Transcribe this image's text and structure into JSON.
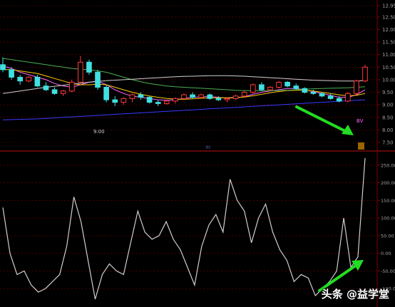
{
  "chart_data": [
    {
      "type": "candlestick",
      "y_axis_ticks": [
        "12.95",
        "12.50",
        "12.00",
        "11.50",
        "11.00",
        "10.50",
        "10.00",
        "9.50",
        "9.00",
        "8.50",
        "8.00",
        "7.50"
      ],
      "ylim": [
        7.5,
        12.95
      ],
      "low_marker_label": "9.00",
      "event_markers": [
        "!!!"
      ],
      "indicator_label": "BV",
      "series": [
        {
          "kind": "candles",
          "ohlc": [
            [
              10.6,
              10.9,
              10.3,
              10.4
            ],
            [
              10.4,
              10.5,
              10.0,
              10.1
            ],
            [
              10.1,
              10.2,
              9.8,
              9.95
            ],
            [
              9.95,
              10.15,
              9.9,
              10.1
            ],
            [
              10.1,
              10.2,
              9.7,
              9.75
            ],
            [
              9.75,
              9.9,
              9.55,
              9.6
            ],
            [
              9.6,
              9.7,
              9.4,
              9.45
            ],
            [
              9.45,
              9.6,
              9.35,
              9.55
            ],
            [
              9.55,
              10.0,
              9.5,
              9.9
            ],
            [
              9.9,
              10.95,
              9.85,
              10.7
            ],
            [
              10.7,
              10.8,
              10.2,
              10.3
            ],
            [
              10.3,
              10.4,
              9.6,
              9.7
            ],
            [
              9.7,
              9.8,
              9.1,
              9.2
            ],
            [
              9.2,
              9.35,
              8.95,
              9.1
            ],
            [
              9.1,
              9.3,
              9.0,
              9.25
            ],
            [
              9.25,
              9.45,
              9.1,
              9.4
            ],
            [
              9.4,
              9.5,
              9.2,
              9.3
            ],
            [
              9.3,
              9.35,
              9.05,
              9.1
            ],
            [
              9.1,
              9.2,
              8.95,
              9.05
            ],
            [
              9.05,
              9.2,
              9.0,
              9.15
            ],
            [
              9.15,
              9.3,
              9.05,
              9.25
            ],
            [
              9.25,
              9.45,
              9.2,
              9.4
            ],
            [
              9.4,
              9.5,
              9.25,
              9.3
            ],
            [
              9.3,
              9.45,
              9.25,
              9.4
            ],
            [
              9.4,
              9.45,
              9.2,
              9.25
            ],
            [
              9.25,
              9.35,
              9.15,
              9.2
            ],
            [
              9.2,
              9.3,
              9.1,
              9.25
            ],
            [
              9.25,
              9.4,
              9.2,
              9.35
            ],
            [
              9.35,
              9.55,
              9.3,
              9.5
            ],
            [
              9.5,
              9.85,
              9.45,
              9.8
            ],
            [
              9.8,
              9.9,
              9.55,
              9.6
            ],
            [
              9.6,
              9.75,
              9.55,
              9.7
            ],
            [
              9.7,
              9.95,
              9.65,
              9.9
            ],
            [
              9.9,
              9.95,
              9.7,
              9.75
            ],
            [
              9.75,
              9.85,
              9.6,
              9.65
            ],
            [
              9.65,
              9.7,
              9.45,
              9.5
            ],
            [
              9.5,
              9.6,
              9.4,
              9.45
            ],
            [
              9.45,
              9.5,
              9.3,
              9.35
            ],
            [
              9.35,
              9.45,
              9.2,
              9.25
            ],
            [
              9.25,
              9.35,
              9.1,
              9.15
            ],
            [
              9.15,
              9.5,
              9.1,
              9.45
            ],
            [
              9.45,
              10.0,
              9.4,
              9.95
            ],
            [
              9.95,
              10.6,
              9.9,
              10.5
            ]
          ]
        },
        {
          "kind": "moving-average",
          "color": "#ff66ff",
          "values": [
            10.55,
            10.45,
            10.3,
            10.2,
            10.1,
            10.0,
            9.85,
            9.75,
            9.7,
            9.8,
            9.9,
            9.95,
            9.8,
            9.6,
            9.45,
            9.35,
            9.3,
            9.25,
            9.2,
            9.18,
            9.2,
            9.25,
            9.3,
            9.32,
            9.33,
            9.3,
            9.27,
            9.28,
            9.32,
            9.42,
            9.5,
            9.55,
            9.6,
            9.65,
            9.65,
            9.6,
            9.52,
            9.45,
            9.38,
            9.3,
            9.3,
            9.4,
            9.6
          ]
        },
        {
          "kind": "moving-average",
          "color": "#ffcc00",
          "values": [
            10.4,
            10.4,
            10.35,
            10.3,
            10.25,
            10.15,
            10.05,
            9.95,
            9.85,
            9.8,
            9.8,
            9.82,
            9.8,
            9.7,
            9.6,
            9.5,
            9.42,
            9.35,
            9.3,
            9.25,
            9.23,
            9.22,
            9.24,
            9.26,
            9.28,
            9.28,
            9.28,
            9.29,
            9.31,
            9.36,
            9.42,
            9.48,
            9.53,
            9.57,
            9.58,
            9.58,
            9.55,
            9.5,
            9.45,
            9.4,
            9.36,
            9.38,
            9.45
          ]
        },
        {
          "kind": "moving-average",
          "color": "#4caf50",
          "values": [
            10.85,
            10.8,
            10.75,
            10.7,
            10.65,
            10.6,
            10.55,
            10.5,
            10.45,
            10.42,
            10.4,
            10.35,
            10.3,
            10.2,
            10.1,
            10.0,
            9.92,
            9.85,
            9.8,
            9.75,
            9.72,
            9.7,
            9.68,
            9.66,
            9.64,
            9.62,
            9.6,
            9.58,
            9.57,
            9.56,
            9.56,
            9.56,
            9.57,
            9.58,
            9.6,
            9.62,
            9.64,
            9.65,
            9.66,
            9.67,
            9.68,
            9.7,
            9.72
          ]
        },
        {
          "kind": "moving-average",
          "color": "#cfcfcf",
          "values": [
            9.45,
            9.5,
            9.55,
            9.6,
            9.65,
            9.7,
            9.74,
            9.78,
            9.82,
            9.86,
            9.9,
            9.93,
            9.96,
            9.98,
            10.0,
            10.02,
            10.04,
            10.06,
            10.08,
            10.1,
            10.12,
            10.13,
            10.14,
            10.15,
            10.16,
            10.16,
            10.16,
            10.15,
            10.14,
            10.12,
            10.1,
            10.08,
            10.06,
            10.04,
            10.02,
            10.0,
            9.98,
            9.97,
            9.96,
            9.95,
            9.95,
            9.95,
            9.96
          ]
        },
        {
          "kind": "moving-average",
          "color": "#3a3aff",
          "values": [
            8.4,
            8.41,
            8.42,
            8.43,
            8.44,
            8.46,
            8.48,
            8.5,
            8.52,
            8.54,
            8.56,
            8.58,
            8.6,
            8.62,
            8.64,
            8.66,
            8.68,
            8.7,
            8.72,
            8.74,
            8.76,
            8.78,
            8.8,
            8.82,
            8.84,
            8.86,
            8.88,
            8.9,
            8.92,
            8.94,
            8.96,
            8.98,
            9.0,
            9.02,
            9.04,
            9.06,
            9.08,
            9.1,
            9.12,
            9.14,
            9.16,
            9.18,
            9.2
          ]
        }
      ]
    },
    {
      "type": "line",
      "y_axis_ticks": [
        "250.00",
        "200.00",
        "150.00",
        "100.00",
        "50.00",
        "0.00",
        "-50.00",
        "-100.00"
      ],
      "ylim": [
        -130,
        270
      ],
      "series": [
        {
          "color": "#cfcfcf",
          "values": [
            130,
            0,
            -60,
            -50,
            -90,
            -110,
            -100,
            -80,
            -60,
            20,
            160,
            90,
            -20,
            -130,
            -60,
            -30,
            -50,
            -60,
            30,
            120,
            60,
            40,
            50,
            90,
            40,
            10,
            -40,
            -90,
            20,
            80,
            110,
            60,
            210,
            150,
            120,
            30,
            100,
            140,
            60,
            10,
            -20,
            -80,
            -60,
            -70,
            -120,
            -100,
            -80,
            -50,
            100,
            -40,
            -10,
            270
          ]
        }
      ]
    }
  ],
  "colors": {
    "background": "#000000",
    "grid": "#7a0000",
    "axis_text": "#a0a0a0",
    "candle_up": "#ff3a3a",
    "candle_down": "#40e0e0",
    "annotation_arrow": "#22dd22"
  },
  "watermark": {
    "text": "头条 @益学堂"
  }
}
